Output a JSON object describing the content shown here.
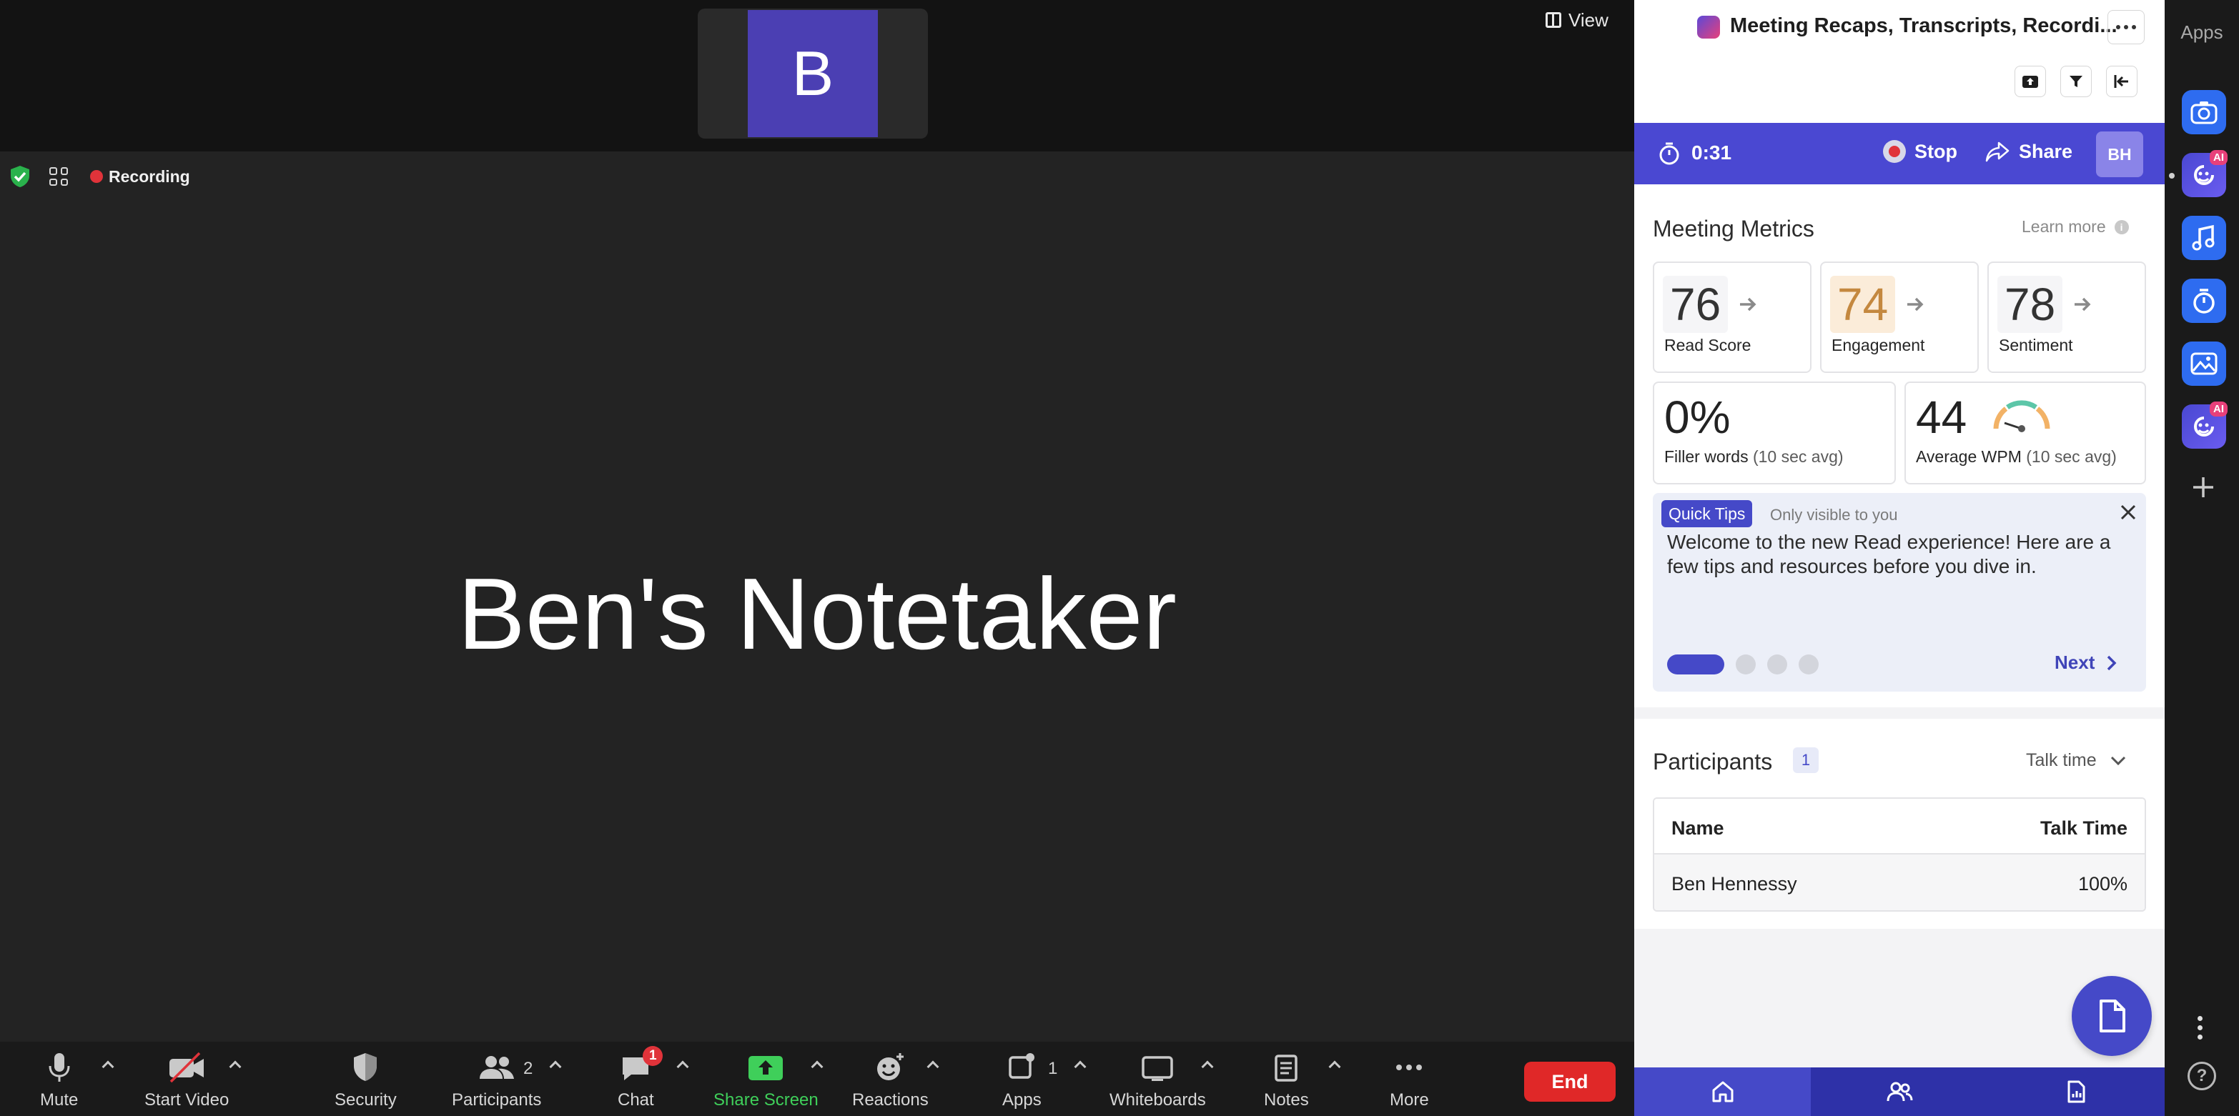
{
  "meeting": {
    "thumbnail_initial": "B",
    "view_label": "View",
    "recording_label": "Recording",
    "participant_display_name": "Ben's Notetaker"
  },
  "toolbar": {
    "mute_label": "Mute",
    "start_video_label": "Start Video",
    "security_label": "Security",
    "participants_label": "Participants",
    "participants_count": "2",
    "chat_label": "Chat",
    "chat_badge": "1",
    "share_screen_label": "Share Screen",
    "reactions_label": "Reactions",
    "apps_label": "Apps",
    "apps_count": "1",
    "whiteboards_label": "Whiteboards",
    "notes_label": "Notes",
    "more_label": "More",
    "end_label": "End"
  },
  "panel": {
    "title": "Meeting Recaps, Transcripts, Recordi...",
    "timer": "0:31",
    "stop_label": "Stop",
    "share_label": "Share",
    "user_initials": "BH",
    "metrics": {
      "title": "Meeting Metrics",
      "learn_more": "Learn more",
      "read_score": {
        "value": "76",
        "label": "Read Score"
      },
      "engagement": {
        "value": "74",
        "label": "Engagement"
      },
      "sentiment": {
        "value": "78",
        "label": "Sentiment"
      },
      "filler_words": {
        "value": "0%",
        "label": "Filler words",
        "sub": "(10 sec avg)"
      },
      "average_wpm": {
        "value": "44",
        "label": "Average WPM",
        "sub": "(10 sec avg)"
      }
    },
    "tips": {
      "badge": "Quick Tips",
      "visibility": "Only visible to you",
      "text": "Welcome to the new Read experience! Here are a few tips and resources before you dive in.",
      "next_label": "Next"
    },
    "participants": {
      "title": "Participants",
      "count": "1",
      "sort_label": "Talk time",
      "col_name": "Name",
      "col_talk": "Talk Time",
      "rows": [
        {
          "name": "Ben Hennessy",
          "talk": "100%"
        }
      ]
    }
  },
  "rail": {
    "title": "Apps"
  },
  "colors": {
    "brand": "#4a48d2",
    "end_red": "#e02828",
    "share_green": "#3fcf5a",
    "engagement_tint": "#fbecd9",
    "engagement_text": "#c4883f"
  }
}
